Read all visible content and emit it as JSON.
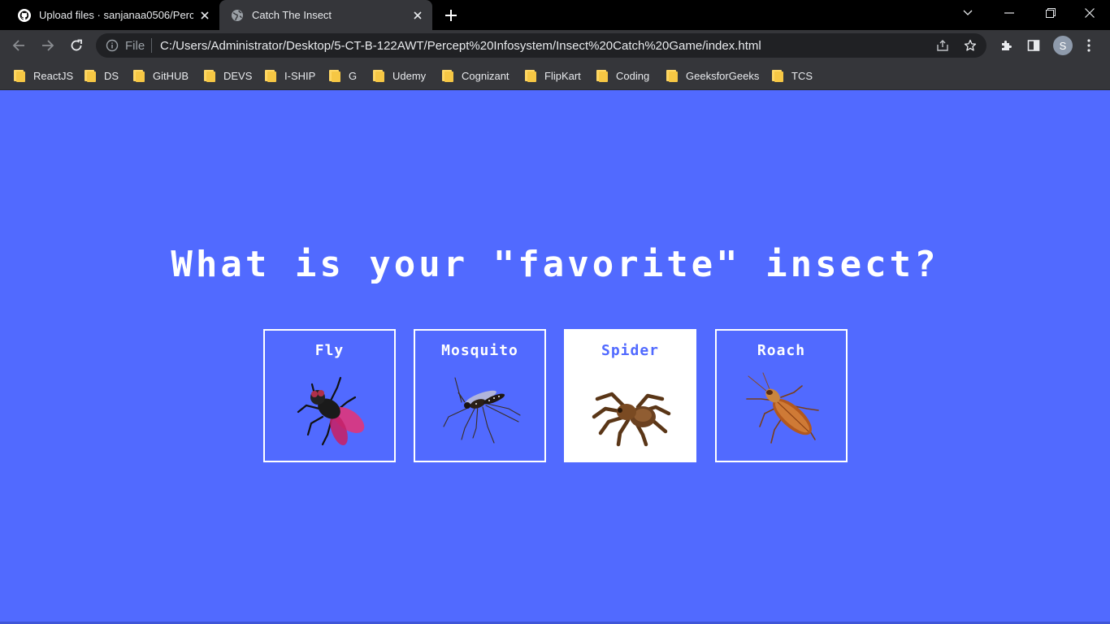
{
  "browser": {
    "tabs": [
      {
        "title": "Upload files · sanjanaa0506/Percept",
        "icon": "github-icon",
        "active": false
      },
      {
        "title": "Catch The Insect",
        "icon": "globe-icon",
        "active": true
      }
    ],
    "scheme_label": "File",
    "url": "C:/Users/Administrator/Desktop/5-CT-B-122AWT/Percept%20Infosystem/Insect%20Catch%20Game/index.html",
    "profile_initial": "S",
    "bookmarks": [
      "ReactJS",
      "DS",
      "GitHUB",
      "DEVS",
      "I-SHIP",
      "G",
      "Udemy",
      "Cognizant",
      "FlipKart",
      "Coding",
      "GeeksforGeeks",
      "TCS"
    ]
  },
  "page": {
    "headline": "What is your \"favorite\" insect?",
    "insects": [
      {
        "name": "Fly",
        "icon": "fly-icon",
        "selected": false
      },
      {
        "name": "Mosquito",
        "icon": "mosquito-icon",
        "selected": false
      },
      {
        "name": "Spider",
        "icon": "spider-icon",
        "selected": true
      },
      {
        "name": "Roach",
        "icon": "roach-icon",
        "selected": false
      }
    ],
    "colors": {
      "background": "#516aff",
      "accent": "#ffffff"
    }
  }
}
